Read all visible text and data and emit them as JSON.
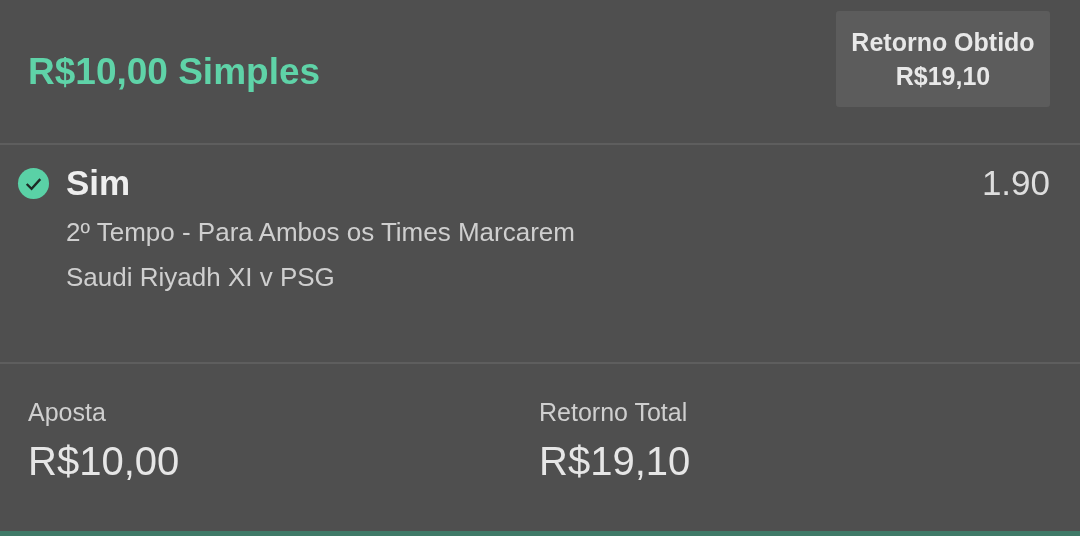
{
  "header": {
    "title": "R$10,00 Simples",
    "return_box": {
      "label": "Retorno Obtido",
      "value": "R$19,10"
    }
  },
  "selection": {
    "won": true,
    "name": "Sim",
    "odds": "1.90",
    "market": "2º Tempo - Para Ambos os Times Marcarem",
    "event": "Saudi Riyadh XI v PSG"
  },
  "summary": [
    {
      "label": "Aposta",
      "value": "R$10,00"
    },
    {
      "label": "Retorno Total",
      "value": "R$19,10"
    }
  ]
}
